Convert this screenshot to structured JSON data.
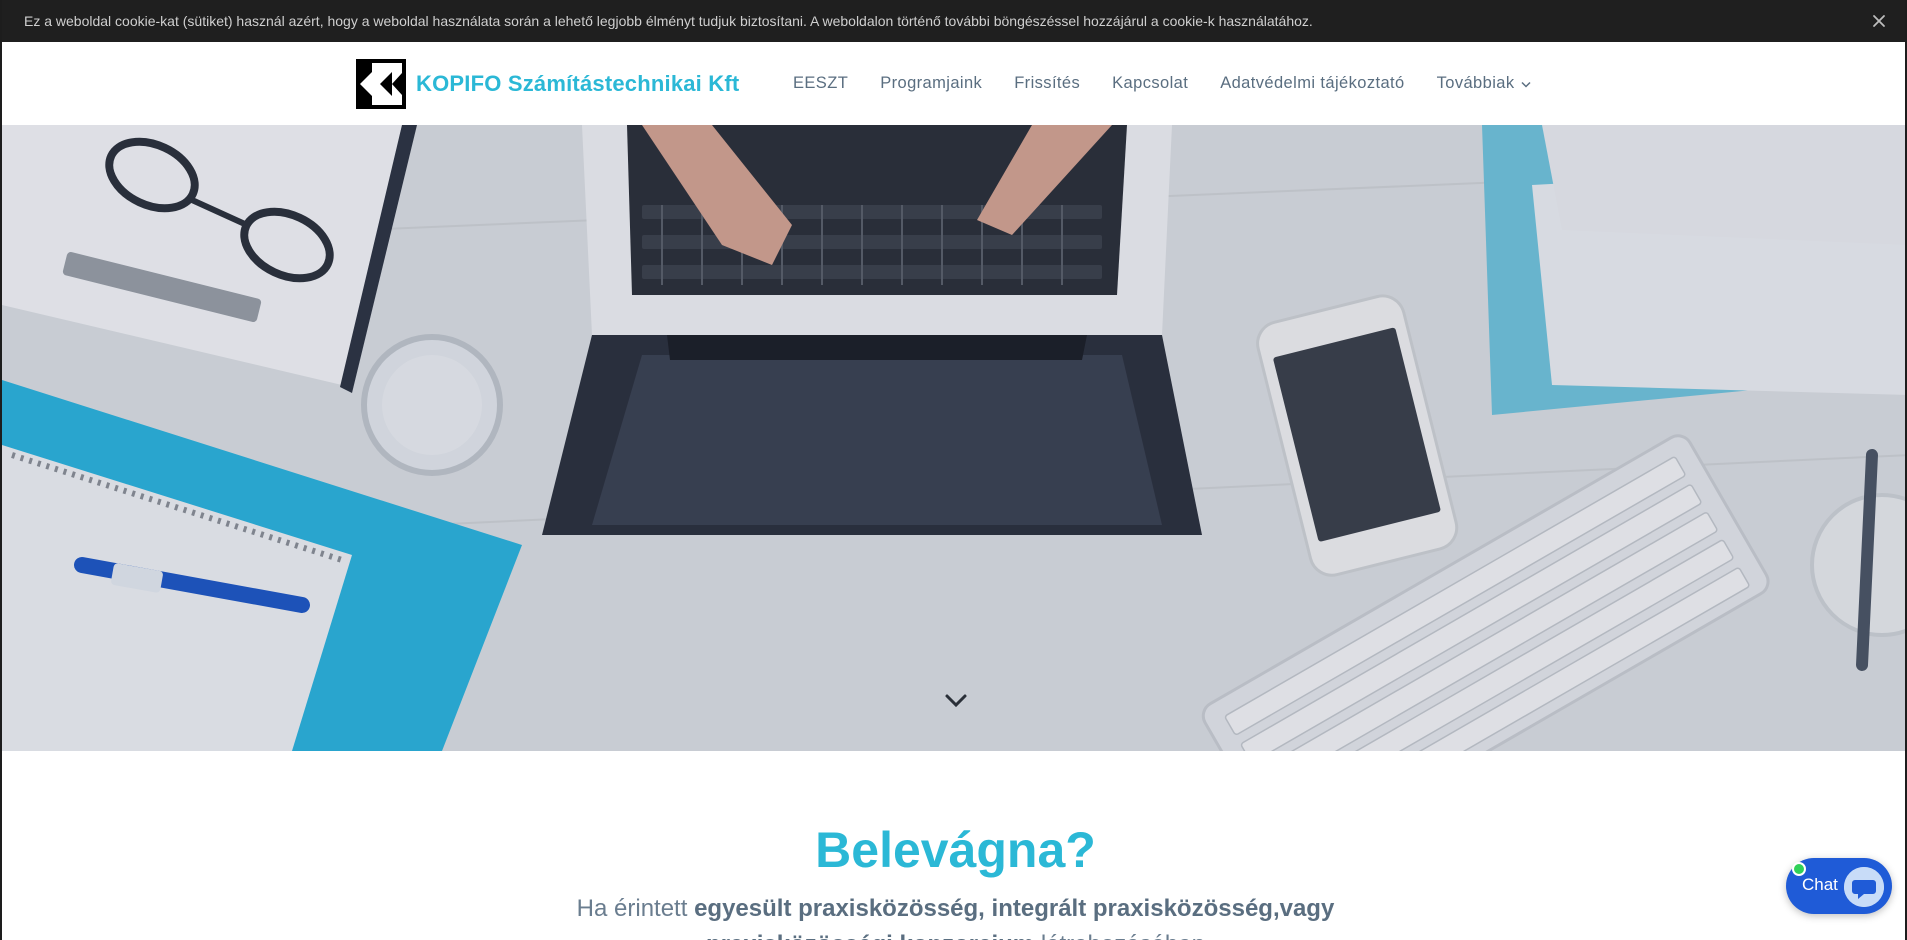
{
  "cookie_bar": {
    "text": "Ez a weboldal cookie-kat (sütiket) használ azért, hogy a weboldal használata során a lehető legjobb élményt tudjuk biztosítani. A weboldalon történő további böngészéssel hozzájárul a cookie-k használatához.",
    "close_icon": "close-icon"
  },
  "header": {
    "logo_text": "KOPIFO Számítástechnikai Kft",
    "nav": [
      "EESZT",
      "Programjaink",
      "Frissítés",
      "Kapcsolat",
      "Adatvédelmi tájékoztató",
      "Továbbiak"
    ]
  },
  "hero": {
    "image": "desk-with-laptop-and-medical-items",
    "scroll_icon": "chevron-down-icon"
  },
  "content": {
    "headline": "Belevágna?",
    "lead_prefix": "Ha érintett ",
    "lead_bold": "egyesült praxisközösség, integrált praxisközösség,vagy",
    "lead_line2_bold": "praxisközösségi konzorcium",
    "lead_line2_rest": " létrehozásában"
  },
  "chat": {
    "label": "Chat",
    "icon": "chat-bubble-icon",
    "status": "online"
  },
  "colors": {
    "accent": "#2bb8d6",
    "nav_text": "#5a6e80",
    "cookie_bg": "#1f1f1f",
    "chat_bg": "#1f5bd7"
  }
}
